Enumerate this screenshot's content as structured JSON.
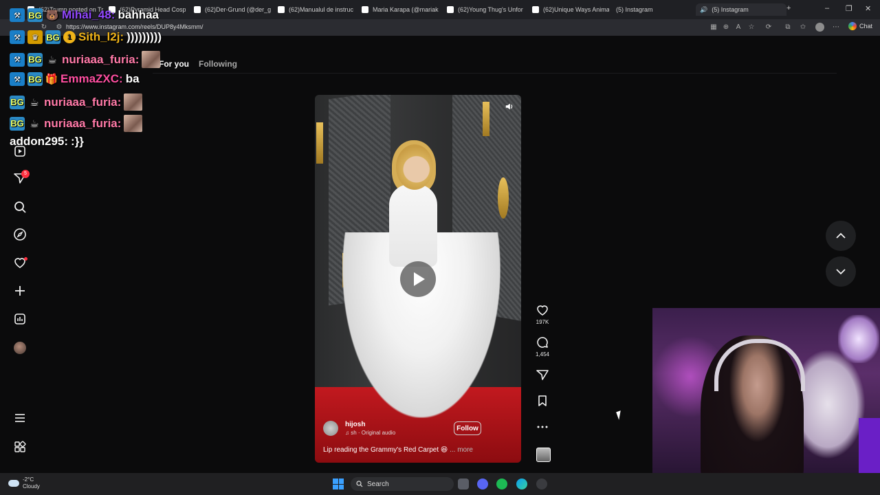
{
  "browser": {
    "tabs": [
      {
        "title": "(62)Trump posted on Tr",
        "icon": "tiktok-icon"
      },
      {
        "title": "(62)Pyramid Head Cosp",
        "icon": "tiktok-icon"
      },
      {
        "title": "(62)Der-Grund (@der_g",
        "icon": "tiktok-icon"
      },
      {
        "title": "(62)Manualul de instruc",
        "icon": "tiktok-icon"
      },
      {
        "title": "Maria Karapa (@mariak",
        "icon": "tiktok-icon"
      },
      {
        "title": "(62)Young Thug's Unfor",
        "icon": "tiktok-icon"
      },
      {
        "title": "(62)Unique Ways Anima",
        "icon": "tiktok-icon"
      },
      {
        "title": "(5) Instagram",
        "icon": "instagram-icon"
      },
      {
        "title": "(5) Instagram",
        "icon": "instagram-icon"
      }
    ],
    "url": "https://www.instagram.com/reels/DUP8y4Mksmm/",
    "chat_label": "Chat"
  },
  "chat": [
    {
      "user": "Mihai_48:",
      "message": "bahhaa",
      "user_color": "#9147ff"
    },
    {
      "user": "Sith_l2j:",
      "message": ")))))))))",
      "user_color": "#f0b419"
    },
    {
      "user": "nuriaaa_furia:",
      "message": "",
      "user_color": "#ff7aa8"
    },
    {
      "user": "EmmaZXC:",
      "message": "ba",
      "user_color": "#ff4fa1"
    },
    {
      "user": "nuriaaa_furia:",
      "message": "",
      "user_color": "#ff7aa8"
    },
    {
      "user": "nuriaaa_furia:",
      "message": "",
      "user_color": "#ff7aa8"
    },
    {
      "user": "addon295:",
      "message": ":}}",
      "user_color": "#ffffff"
    }
  ],
  "feed": {
    "tab_for_you": "For you",
    "tab_following": "Following"
  },
  "sidebar": {
    "notification_count": "5"
  },
  "reel": {
    "username": "hijosh",
    "audio": "sh · Original audio",
    "follow_label": "Follow",
    "caption": "Lip reading the Grammy's Red Carpet 😆",
    "more_label": "... more",
    "likes": "197K",
    "comments": "1,454"
  },
  "taskbar": {
    "temperature": "-2°C",
    "weather": "Cloudy",
    "search_label": "Search"
  }
}
